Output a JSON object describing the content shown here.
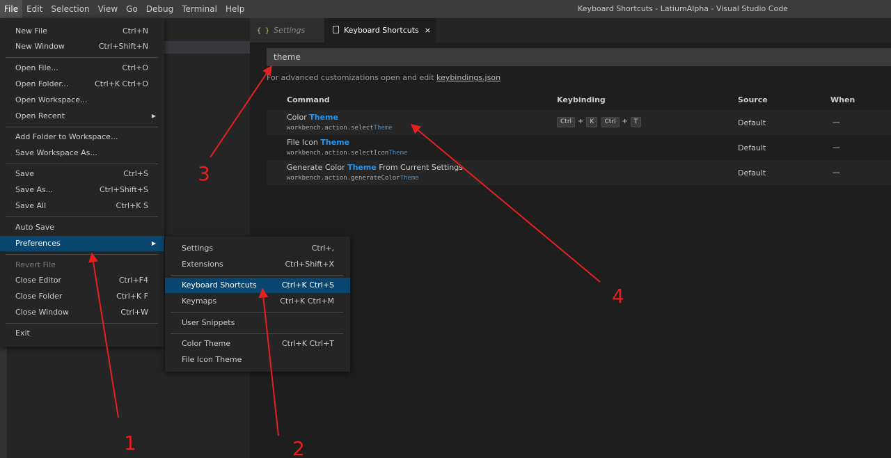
{
  "menubar": {
    "items": [
      "File",
      "Edit",
      "Selection",
      "View",
      "Go",
      "Debug",
      "Terminal",
      "Help"
    ]
  },
  "window_title": "Keyboard Shortcuts - LatiumAlpha - Visual Studio Code",
  "tabs": {
    "settings": "Settings",
    "keyboard_shortcuts": "Keyboard Shortcuts",
    "braces_glyph": "{ }",
    "close_glyph": "×"
  },
  "search": {
    "value": "theme"
  },
  "hint": {
    "text": "For advanced customizations open and edit ",
    "link": "keybindings.json"
  },
  "table": {
    "headers": {
      "command": "Command",
      "keybinding": "Keybinding",
      "source": "Source",
      "when": "When"
    },
    "rows": [
      {
        "cmd_pre": "Color ",
        "cmd_hl": "Theme",
        "cmd_post": "",
        "id_pre": "workbench.action.select",
        "id_hl": "Theme",
        "id_post": "",
        "keys": [
          "Ctrl",
          "K",
          "Ctrl",
          "T"
        ],
        "source": "Default",
        "when": "—"
      },
      {
        "cmd_pre": "File Icon ",
        "cmd_hl": "Theme",
        "cmd_post": "",
        "id_pre": "workbench.action.selectIcon",
        "id_hl": "Theme",
        "id_post": "",
        "source": "Default",
        "when": "—"
      },
      {
        "cmd_pre": "Generate Color ",
        "cmd_hl": "Theme",
        "cmd_post": " From Current Settings",
        "id_pre": "workbench.action.generateColor",
        "id_hl": "Theme",
        "id_post": "",
        "source": "Default",
        "when": "—"
      }
    ],
    "plus": "+"
  },
  "file_menu": {
    "items": [
      {
        "label": "New File",
        "shortcut": "Ctrl+N"
      },
      {
        "label": "New Window",
        "shortcut": "Ctrl+Shift+N"
      },
      {
        "label": "Open File...",
        "shortcut": "Ctrl+O"
      },
      {
        "label": "Open Folder...",
        "shortcut": "Ctrl+K Ctrl+O"
      },
      {
        "label": "Open Workspace...",
        "shortcut": ""
      },
      {
        "label": "Open Recent",
        "shortcut": "",
        "submenu": true
      },
      {
        "label": "Add Folder to Workspace...",
        "shortcut": ""
      },
      {
        "label": "Save Workspace As...",
        "shortcut": ""
      },
      {
        "label": "Save",
        "shortcut": "Ctrl+S"
      },
      {
        "label": "Save As...",
        "shortcut": "Ctrl+Shift+S"
      },
      {
        "label": "Save All",
        "shortcut": "Ctrl+K S"
      },
      {
        "label": "Auto Save",
        "shortcut": ""
      },
      {
        "label": "Preferences",
        "shortcut": "",
        "submenu": true,
        "selected": true
      },
      {
        "label": "Revert File",
        "shortcut": "",
        "disabled": true
      },
      {
        "label": "Close Editor",
        "shortcut": "Ctrl+F4"
      },
      {
        "label": "Close Folder",
        "shortcut": "Ctrl+K F"
      },
      {
        "label": "Close Window",
        "shortcut": "Ctrl+W"
      },
      {
        "label": "Exit",
        "shortcut": ""
      }
    ],
    "arrow_glyph": "▶"
  },
  "preferences_menu": {
    "items": [
      {
        "label": "Settings",
        "shortcut": "Ctrl+,"
      },
      {
        "label": "Extensions",
        "shortcut": "Ctrl+Shift+X"
      },
      {
        "label": "Keyboard Shortcuts",
        "shortcut": "Ctrl+K Ctrl+S",
        "selected": true
      },
      {
        "label": "Keymaps",
        "shortcut": "Ctrl+K Ctrl+M"
      },
      {
        "label": "User Snippets",
        "shortcut": ""
      },
      {
        "label": "Color Theme",
        "shortcut": "Ctrl+K Ctrl+T"
      },
      {
        "label": "File Icon Theme",
        "shortcut": ""
      }
    ]
  },
  "annotations": {
    "color": "#e81f1f",
    "labels": [
      "1",
      "2",
      "3",
      "4"
    ]
  }
}
